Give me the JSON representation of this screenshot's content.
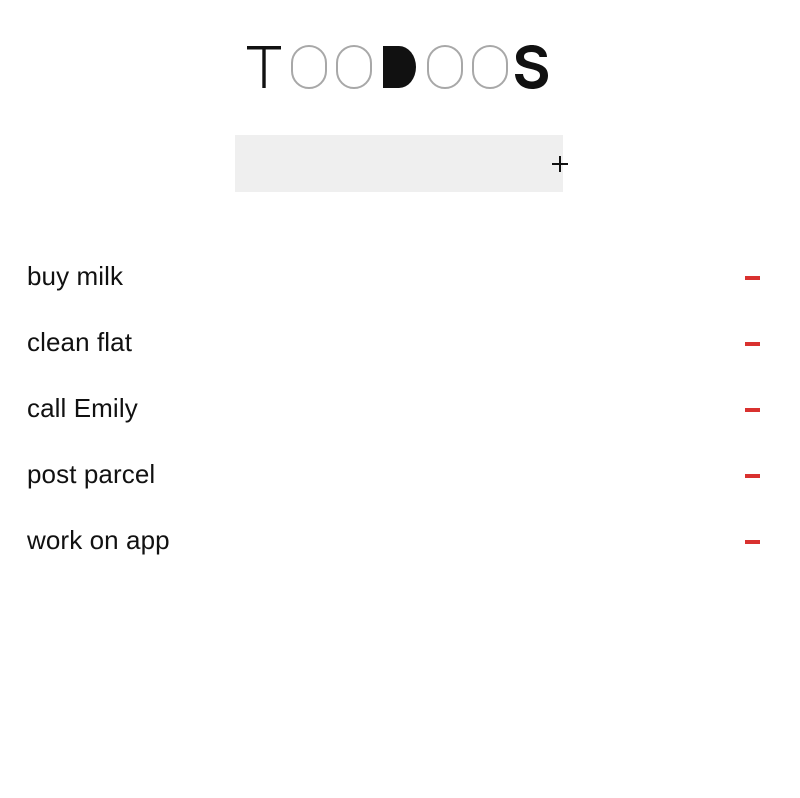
{
  "app": {
    "logo_text": "TOODOOS",
    "colors": {
      "text": "#111111",
      "outline_letter": "#a8a8a8",
      "input_background": "#efefef",
      "remove_accent": "#d9312f"
    }
  },
  "add_form": {
    "input_value": "",
    "input_placeholder": "",
    "add_icon": "plus-icon"
  },
  "todos": [
    {
      "label": "buy milk",
      "remove_icon": "minus-icon"
    },
    {
      "label": "clean flat",
      "remove_icon": "minus-icon"
    },
    {
      "label": "call Emily",
      "remove_icon": "minus-icon"
    },
    {
      "label": "post parcel",
      "remove_icon": "minus-icon"
    },
    {
      "label": "work on app",
      "remove_icon": "minus-icon"
    }
  ]
}
